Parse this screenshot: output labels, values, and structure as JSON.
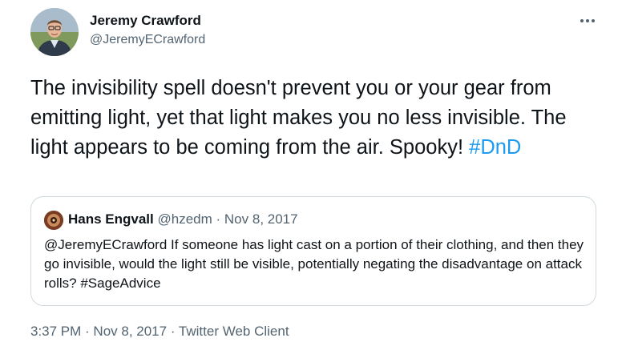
{
  "author": {
    "name": "Jeremy Crawford",
    "handle": "@JeremyECrawford"
  },
  "more_icon": "more-horizontal-icon",
  "tweet": {
    "text": "The invisibility spell doesn't prevent you or your gear from emitting light, yet that light makes you no less invisible. The light appears to be coming from the air. Spooky! ",
    "hashtag": "#DnD"
  },
  "quoted_tweet": {
    "name": "Hans Engvall",
    "handle": "@hzedm",
    "separator": " · ",
    "date": "Nov 8, 2017",
    "text": "@JeremyECrawford If someone has light cast on a portion of their clothing, and then they go invisible, would the light still be visible, potentially negating the disadvantage on attack rolls? #SageAdvice"
  },
  "footer": {
    "time": "3:37 PM",
    "separator": " · ",
    "date": "Nov 8, 2017",
    "source": "Twitter Web Client"
  },
  "colors": {
    "text": "#0f1419",
    "secondary": "#536471",
    "link": "#1d9bf0",
    "border": "#cfd9de"
  }
}
